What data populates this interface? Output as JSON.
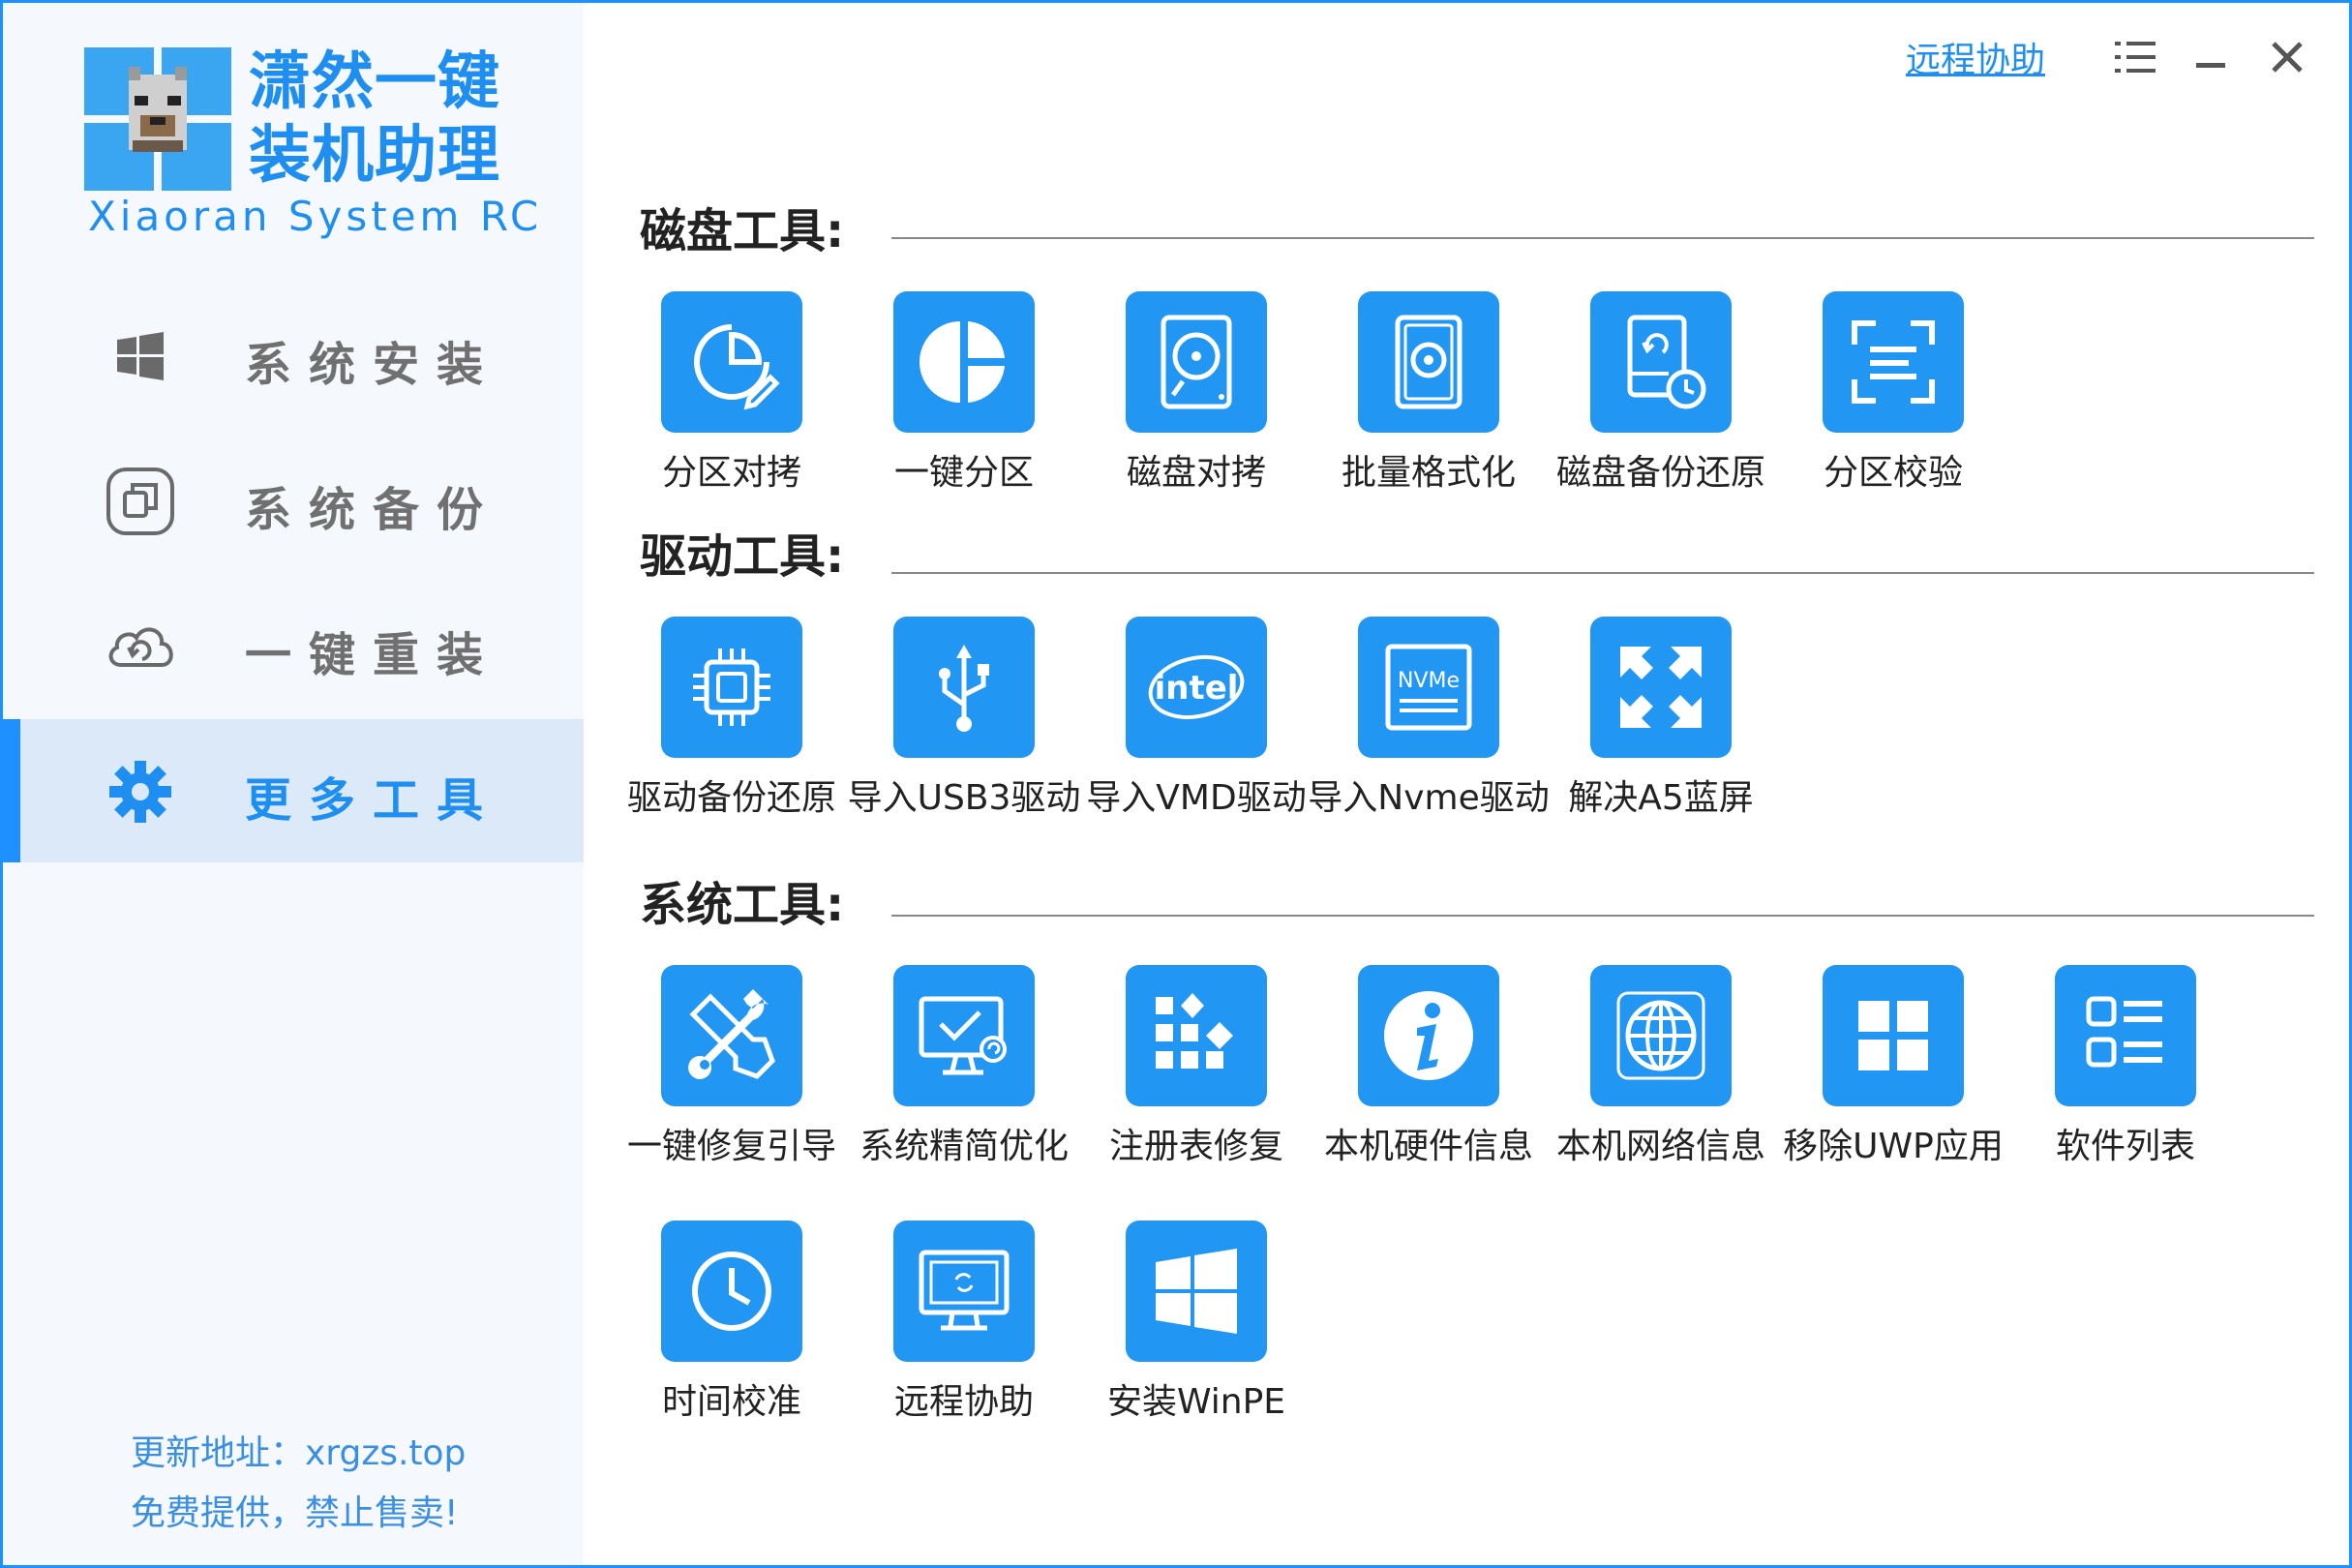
{
  "sidebar": {
    "logo": {
      "title_line1": "潇然一键",
      "title_line2": "装机助理",
      "subtitle": "Xiaoran System RC"
    },
    "items": [
      {
        "label": "系统安装",
        "icon": "windows-icon",
        "active": false
      },
      {
        "label": "系统备份",
        "icon": "backup-icon",
        "active": false
      },
      {
        "label": "一键重装",
        "icon": "cloud-refresh-icon",
        "active": false
      },
      {
        "label": "更多工具",
        "icon": "gear-icon",
        "active": true
      }
    ],
    "footer": {
      "update_line": "更新地址：xrgzs.top",
      "free_line": "免费提供，禁止售卖!"
    }
  },
  "titlebar": {
    "remote_assist_link": "远程协助",
    "menu_icon": "menu-icon",
    "minimize_icon": "minimize-icon",
    "close_icon": "close-icon"
  },
  "sections": {
    "disk": {
      "title": "磁盘工具:",
      "tools": [
        {
          "label": "分区对拷",
          "icon": "partition-copy-icon"
        },
        {
          "label": "一键分区",
          "icon": "pie-partition-icon"
        },
        {
          "label": "磁盘对拷",
          "icon": "disk-copy-icon"
        },
        {
          "label": "批量格式化",
          "icon": "format-icon"
        },
        {
          "label": "磁盘备份还原",
          "icon": "disk-backup-icon"
        },
        {
          "label": "分区校验",
          "icon": "partition-verify-icon"
        }
      ]
    },
    "driver": {
      "title": "驱动工具:",
      "tools": [
        {
          "label": "驱动备份还原",
          "icon": "chip-icon"
        },
        {
          "label": "导入USB3驱动",
          "icon": "usb-icon"
        },
        {
          "label": "导入VMD驱动",
          "icon": "intel-icon",
          "icon_text": "intel"
        },
        {
          "label": "导入Nvme驱动",
          "icon": "nvme-icon",
          "icon_text": "NVMe"
        },
        {
          "label": "解决A5蓝屏",
          "icon": "expand-arrows-icon"
        }
      ]
    },
    "system": {
      "title": "系统工具:",
      "tools": [
        {
          "label": "一键修复引导",
          "icon": "wrench-icon"
        },
        {
          "label": "系统精简优化",
          "icon": "monitor-check-icon"
        },
        {
          "label": "注册表修复",
          "icon": "registry-icon"
        },
        {
          "label": "本机硬件信息",
          "icon": "info-icon"
        },
        {
          "label": "本机网络信息",
          "icon": "globe-icon"
        },
        {
          "label": "移除UWP应用",
          "icon": "uwp-grid-icon"
        },
        {
          "label": "软件列表",
          "icon": "list-icon"
        },
        {
          "label": "时间校准",
          "icon": "clock-icon"
        },
        {
          "label": "远程协助",
          "icon": "remote-monitor-icon"
        },
        {
          "label": "安装WinPE",
          "icon": "windows-logo-icon"
        }
      ]
    }
  },
  "colors": {
    "accent": "#1e8ff0",
    "tile": "#2196f3",
    "sidebar_bg": "#f5f8fc",
    "active_bg": "#dbe9f8"
  }
}
